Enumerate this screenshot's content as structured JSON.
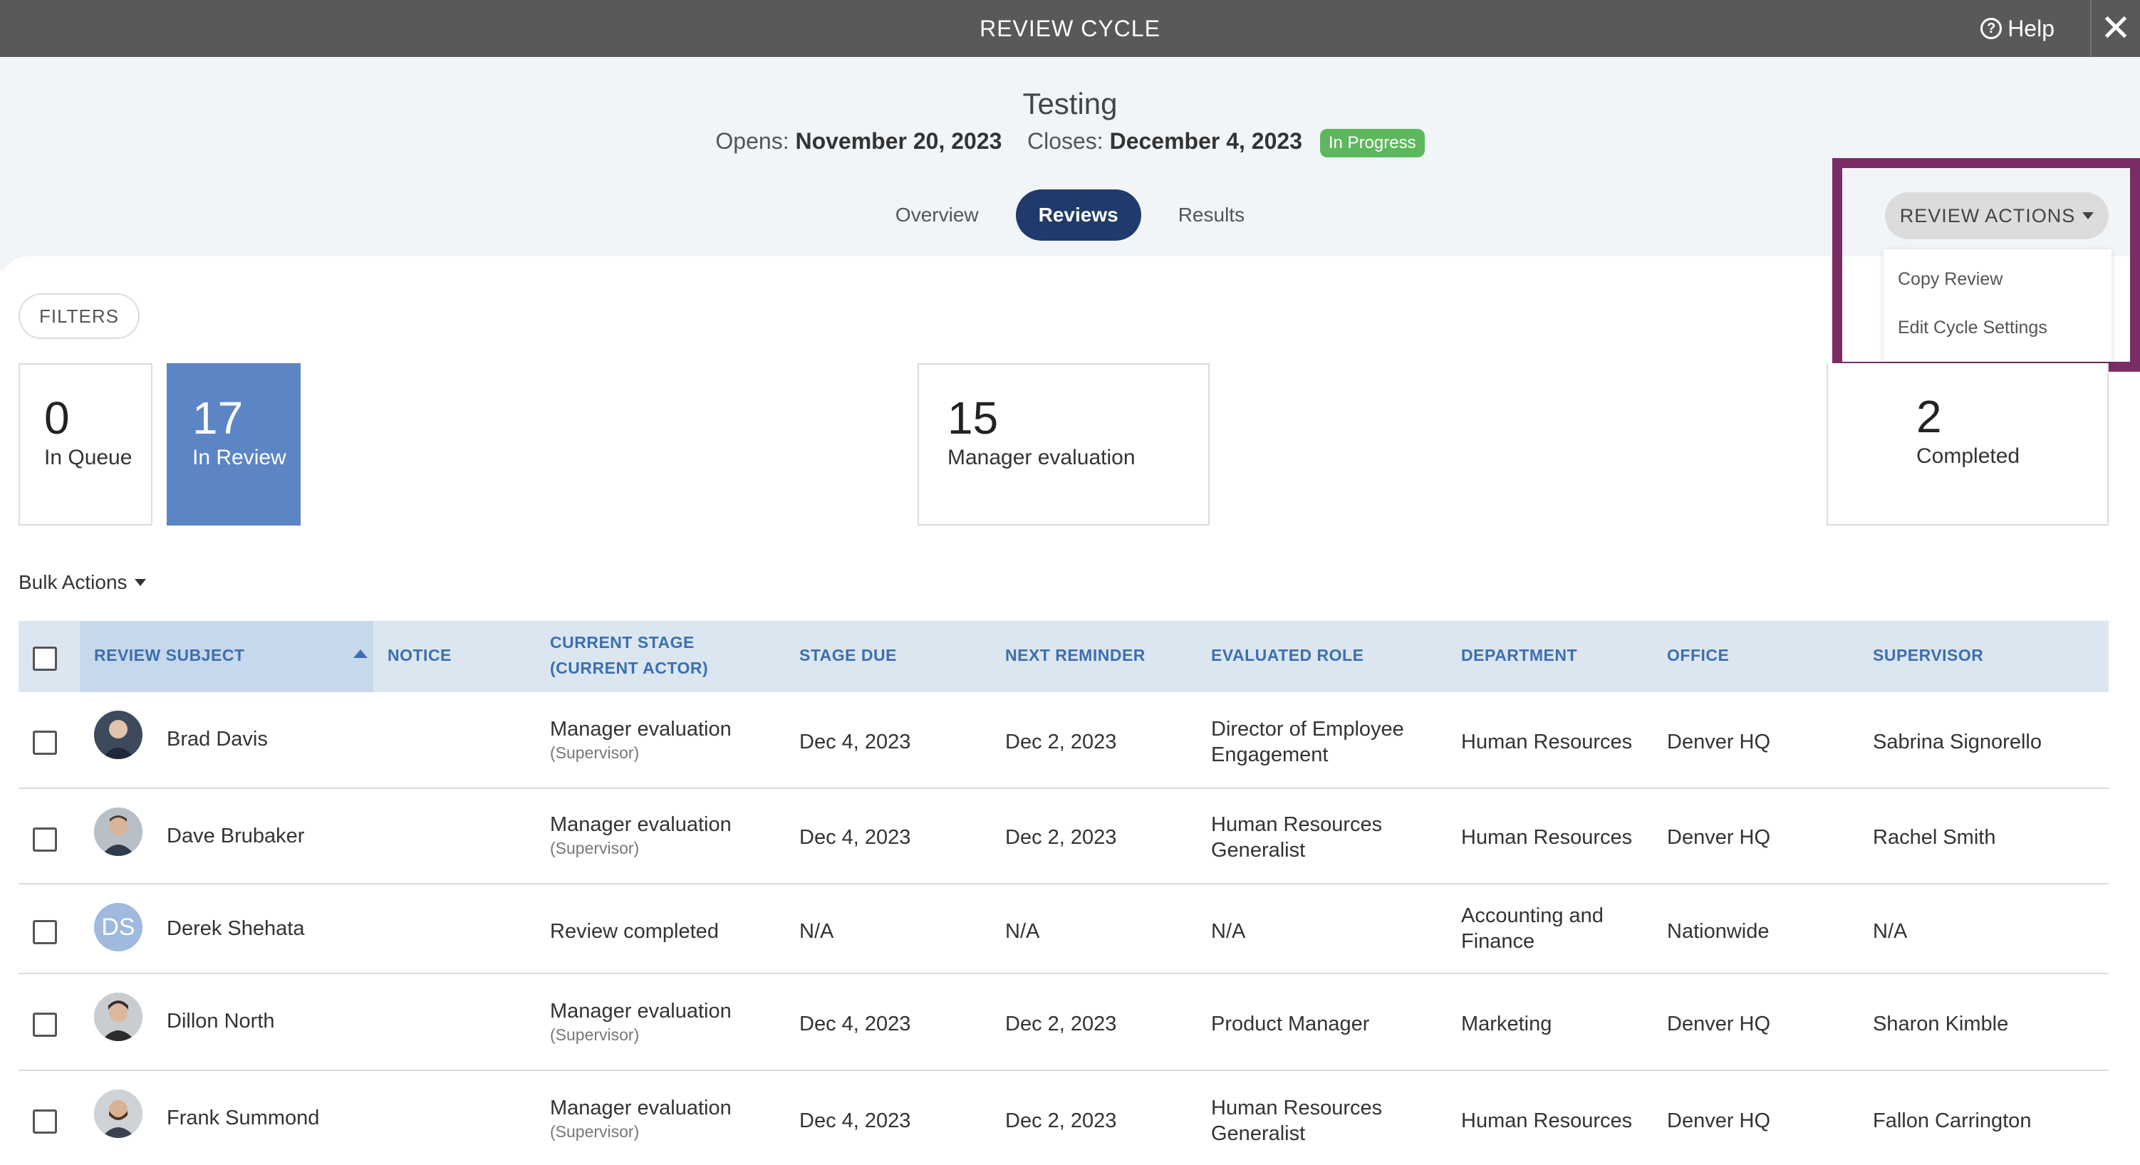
{
  "topbar": {
    "title": "REVIEW CYCLE",
    "help_label": "Help",
    "help_glyph": "?",
    "close_glyph": "✕"
  },
  "cycle": {
    "name": "Testing",
    "opens_label": "Opens:",
    "opens_date": "November 20, 2023",
    "closes_label": "Closes:",
    "closes_date": "December 4, 2023",
    "status": "In Progress",
    "status_color": "#5cb85c"
  },
  "tabs": [
    {
      "label": "Overview"
    },
    {
      "label": "Reviews"
    },
    {
      "label": "Results"
    }
  ],
  "review_actions": {
    "label": "REVIEW ACTIONS",
    "menu": [
      {
        "label": "Copy Review"
      },
      {
        "label": "Edit Cycle Settings"
      }
    ],
    "highlight_color": "#7c2c64"
  },
  "filters_label": "FILTERS",
  "stats": [
    {
      "count": "0",
      "label": "In Queue"
    },
    {
      "count": "17",
      "label": "In Review"
    },
    {
      "count": "15",
      "label": "Manager evaluation"
    },
    {
      "count": "2",
      "label": "Completed"
    }
  ],
  "bulk_actions_label": "Bulk Actions",
  "table": {
    "headers": {
      "subject": "REVIEW SUBJECT",
      "notice": "NOTICE",
      "stage_line1": "CURRENT STAGE",
      "stage_line2": "(CURRENT ACTOR)",
      "due": "STAGE DUE",
      "reminder": "NEXT REMINDER",
      "role": "EVALUATED ROLE",
      "department": "DEPARTMENT",
      "office": "OFFICE",
      "supervisor": "SUPERVISOR"
    },
    "rows": [
      {
        "name": "Brad Davis",
        "stage": "Manager evaluation",
        "actor": "(Supervisor)",
        "due": "Dec 4, 2023",
        "reminder": "Dec 2, 2023",
        "role_line1": "Director of Employee",
        "role_line2": "Engagement",
        "department_line1": "Human Resources",
        "department_line2": "",
        "office": "Denver HQ",
        "supervisor": "Sabrina Signorello"
      },
      {
        "name": "Dave Brubaker",
        "stage": "Manager evaluation",
        "actor": "(Supervisor)",
        "due": "Dec 4, 2023",
        "reminder": "Dec 2, 2023",
        "role_line1": "Human Resources",
        "role_line2": "Generalist",
        "department_line1": "Human Resources",
        "department_line2": "",
        "office": "Denver HQ",
        "supervisor": "Rachel Smith"
      },
      {
        "name": "Derek Shehata",
        "initials": "DS",
        "stage": "Review completed",
        "actor": "",
        "due": "N/A",
        "reminder": "N/A",
        "role_line1": "N/A",
        "role_line2": "",
        "department_line1": "Accounting and",
        "department_line2": "Finance",
        "office": "Nationwide",
        "supervisor": "N/A"
      },
      {
        "name": "Dillon North",
        "stage": "Manager evaluation",
        "actor": "(Supervisor)",
        "due": "Dec 4, 2023",
        "reminder": "Dec 2, 2023",
        "role_line1": "Product Manager",
        "role_line2": "",
        "department_line1": "Marketing",
        "department_line2": "",
        "office": "Denver HQ",
        "supervisor": "Sharon Kimble"
      },
      {
        "name": "Frank Summond",
        "stage": "Manager evaluation",
        "actor": "(Supervisor)",
        "due": "Dec 4, 2023",
        "reminder": "Dec 2, 2023",
        "role_line1": "Human Resources",
        "role_line2": "Generalist",
        "department_line1": "Human Resources",
        "department_line2": "",
        "office": "Denver HQ",
        "supervisor": "Fallon Carrington"
      }
    ]
  }
}
